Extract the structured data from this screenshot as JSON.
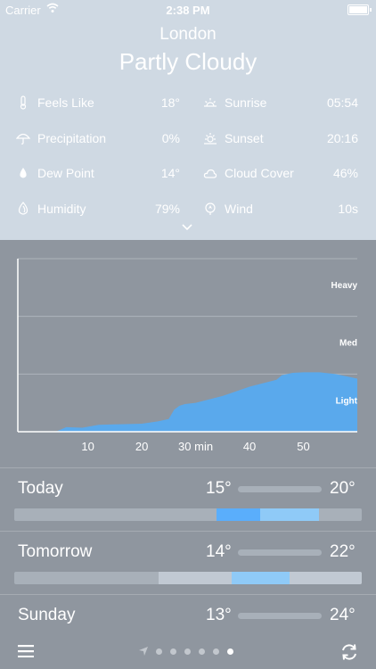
{
  "status": {
    "carrier": "Carrier",
    "time": "2:38 PM"
  },
  "header": {
    "city": "London",
    "condition": "Partly Cloudy"
  },
  "details_left": [
    {
      "label": "Feels Like",
      "value": "18°",
      "icon": "thermometer-icon"
    },
    {
      "label": "Precipitation",
      "value": "0%",
      "icon": "umbrella-icon"
    },
    {
      "label": "Dew Point",
      "value": "14°",
      "icon": "drop-icon"
    },
    {
      "label": "Humidity",
      "value": "79%",
      "icon": "humidity-icon"
    }
  ],
  "details_right": [
    {
      "label": "Sunrise",
      "value": "05:54",
      "icon": "sunrise-icon"
    },
    {
      "label": "Sunset",
      "value": "20:16",
      "icon": "sunset-icon"
    },
    {
      "label": "Cloud Cover",
      "value": "46%",
      "icon": "cloud-icon"
    },
    {
      "label": "Wind",
      "value": "10s",
      "icon": "wind-icon"
    }
  ],
  "chart_data": {
    "type": "area",
    "x_ticks": [
      "10",
      "20",
      "30 min",
      "40",
      "50"
    ],
    "levels": [
      "Heavy",
      "Med",
      "Light"
    ],
    "x": [
      0,
      4,
      6,
      9,
      12,
      16,
      20,
      23,
      25,
      26,
      27,
      28,
      30,
      35,
      40,
      45,
      46,
      48,
      50,
      53,
      56,
      58,
      60
    ],
    "y": [
      0,
      0,
      0.08,
      0.07,
      0.12,
      0.13,
      0.14,
      0.18,
      0.22,
      0.38,
      0.45,
      0.48,
      0.5,
      0.62,
      0.78,
      0.9,
      0.98,
      1.02,
      1.03,
      1.03,
      1.0,
      0.96,
      0.92
    ],
    "xlim": [
      -3,
      60
    ],
    "ylim": [
      0,
      3
    ],
    "fill_color": "#5aa9ec"
  },
  "days": [
    {
      "name": "Today",
      "low": "15°",
      "high": "20°"
    },
    {
      "name": "Tomorrow",
      "low": "14°",
      "high": "22°"
    },
    {
      "name": "Sunday",
      "low": "13°",
      "high": "24°"
    }
  ],
  "colors": {
    "top_bg": "#cfd9e3",
    "bottom_bg": "#8f969f",
    "accent": "#5aa9ec"
  }
}
